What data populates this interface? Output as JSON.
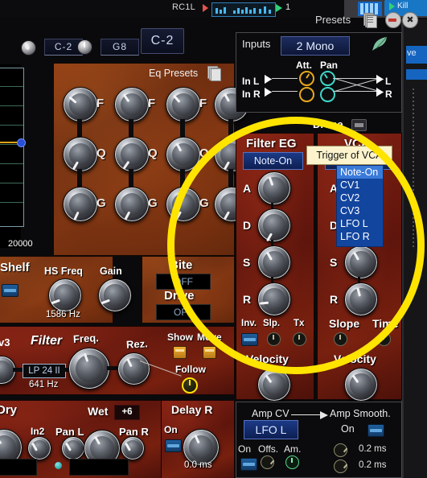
{
  "host": {
    "track_label": "RC1L",
    "pattern_number": "1",
    "kill_label": "Kill"
  },
  "window": {
    "presets_label": "Presets",
    "presets_icon": "pages-icon",
    "minimize_icon": "minimize-icon",
    "close_icon": "close-icon"
  },
  "keyrange": {
    "low_note": "C-2",
    "high_note": "G8",
    "display_note": "C-2"
  },
  "eq": {
    "presets_label": "Eq Presets",
    "graph_max_freq": "20000",
    "band_labels": [
      "F",
      "Q",
      "G"
    ],
    "bands": 4
  },
  "shelf": {
    "title": "Shelf",
    "hs_freq_label": "HS Freq",
    "hs_freq_value": "1586 Hz",
    "gain_label": "Gain"
  },
  "bite_drive": {
    "bite_label": "Bite",
    "bite_value": "OFF",
    "drive_label": "Drive",
    "drive_value": "OFF"
  },
  "filter": {
    "version_label": "v3",
    "title": "Filter",
    "type": "LP 24 II",
    "cutoff_value": "641 Hz",
    "freq_label": "Freq.",
    "rez_label": "Rez.",
    "show_label": "Show",
    "move_label": "Move",
    "follow_label": "Follow"
  },
  "mixer": {
    "dry_label": "Dry",
    "wet_label": "Wet",
    "wet_value": "+6",
    "in2_label": "In2",
    "pan_l_label": "Pan L",
    "pan_r_label": "Pan R"
  },
  "delay": {
    "title": "Delay R",
    "on_label": "On",
    "value": "0.0 ms"
  },
  "inputs": {
    "title": "Inputs",
    "mode": "2 Mono",
    "leaf_icon": "leaf-icon",
    "att_label": "Att.",
    "pan_label": "Pan",
    "in_l_label": "In L",
    "in_r_label": "In R",
    "out_l_label": "L",
    "out_r_label": "R"
  },
  "drone": {
    "label": "Drone"
  },
  "filter_eg": {
    "title": "Filter EG",
    "trigger": "Note-On",
    "stages": [
      "A",
      "D",
      "S",
      "R"
    ],
    "inv_label": "Inv.",
    "slp_label": "Slp.",
    "tx_label": "Tx",
    "velocity_label": "Velocity"
  },
  "vca": {
    "title": "VCA",
    "trigger": "Note-On",
    "stages": [
      "A",
      "D",
      "S",
      "R"
    ],
    "slope_label": "Slope",
    "time_label": "Time",
    "velocity_label": "Velocity"
  },
  "tooltip": {
    "text": "Trigger of VCA"
  },
  "dropdown": {
    "options": [
      "Note-On",
      "CV1",
      "CV2",
      "CV3",
      "LFO L",
      "LFO R"
    ],
    "selected": "Note-On"
  },
  "amp_cv": {
    "title": "Amp CV",
    "source": "LFO L",
    "smooth_title": "Amp Smooth.",
    "smooth_on_label": "On",
    "on_label": "On",
    "offs_label": "Offs.",
    "am_label": "Am.",
    "smooth_value_1": "0.2 ms",
    "smooth_value_2": "0.2 ms"
  },
  "colors": {
    "highlight": "#ffe400",
    "blue_button": "#1c3a86",
    "tooltip_bg": "#fdf4ce",
    "rust": "#7e3512"
  }
}
